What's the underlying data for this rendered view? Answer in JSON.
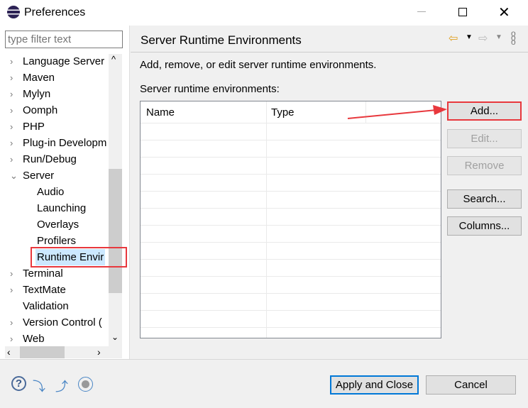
{
  "window": {
    "title": "Preferences"
  },
  "filter": {
    "placeholder": "type filter text"
  },
  "tree": [
    {
      "label": "Language Server",
      "expand": "›"
    },
    {
      "label": "Maven",
      "expand": "›"
    },
    {
      "label": "Mylyn",
      "expand": "›"
    },
    {
      "label": "Oomph",
      "expand": "›"
    },
    {
      "label": "PHP",
      "expand": "›"
    },
    {
      "label": "Plug-in Developm",
      "expand": "›"
    },
    {
      "label": "Run/Debug",
      "expand": "›"
    },
    {
      "label": "Server",
      "expand": "⌄"
    },
    {
      "label": "Audio",
      "child": true
    },
    {
      "label": "Launching",
      "child": true
    },
    {
      "label": "Overlays",
      "child": true
    },
    {
      "label": "Profilers",
      "child": true
    },
    {
      "label": "Runtime Envir",
      "child": true,
      "selected": true
    },
    {
      "label": "Terminal",
      "expand": "›"
    },
    {
      "label": "TextMate",
      "expand": "›"
    },
    {
      "label": "Validation"
    },
    {
      "label": "Version Control (",
      "expand": "›"
    },
    {
      "label": "Web",
      "expand": "›"
    }
  ],
  "page": {
    "title": "Server Runtime Environments",
    "description": "Add, remove, or edit server runtime environments.",
    "list_label": "Server runtime environments:"
  },
  "table": {
    "columns": [
      "Name",
      "Type",
      ""
    ]
  },
  "buttons": {
    "add": "Add...",
    "edit": "Edit...",
    "remove": "Remove",
    "search": "Search...",
    "columns": "Columns..."
  },
  "footer": {
    "apply_close": "Apply and Close",
    "cancel": "Cancel"
  },
  "colors": {
    "highlight": "#e8383d",
    "back_arrow": "#e0a020"
  }
}
